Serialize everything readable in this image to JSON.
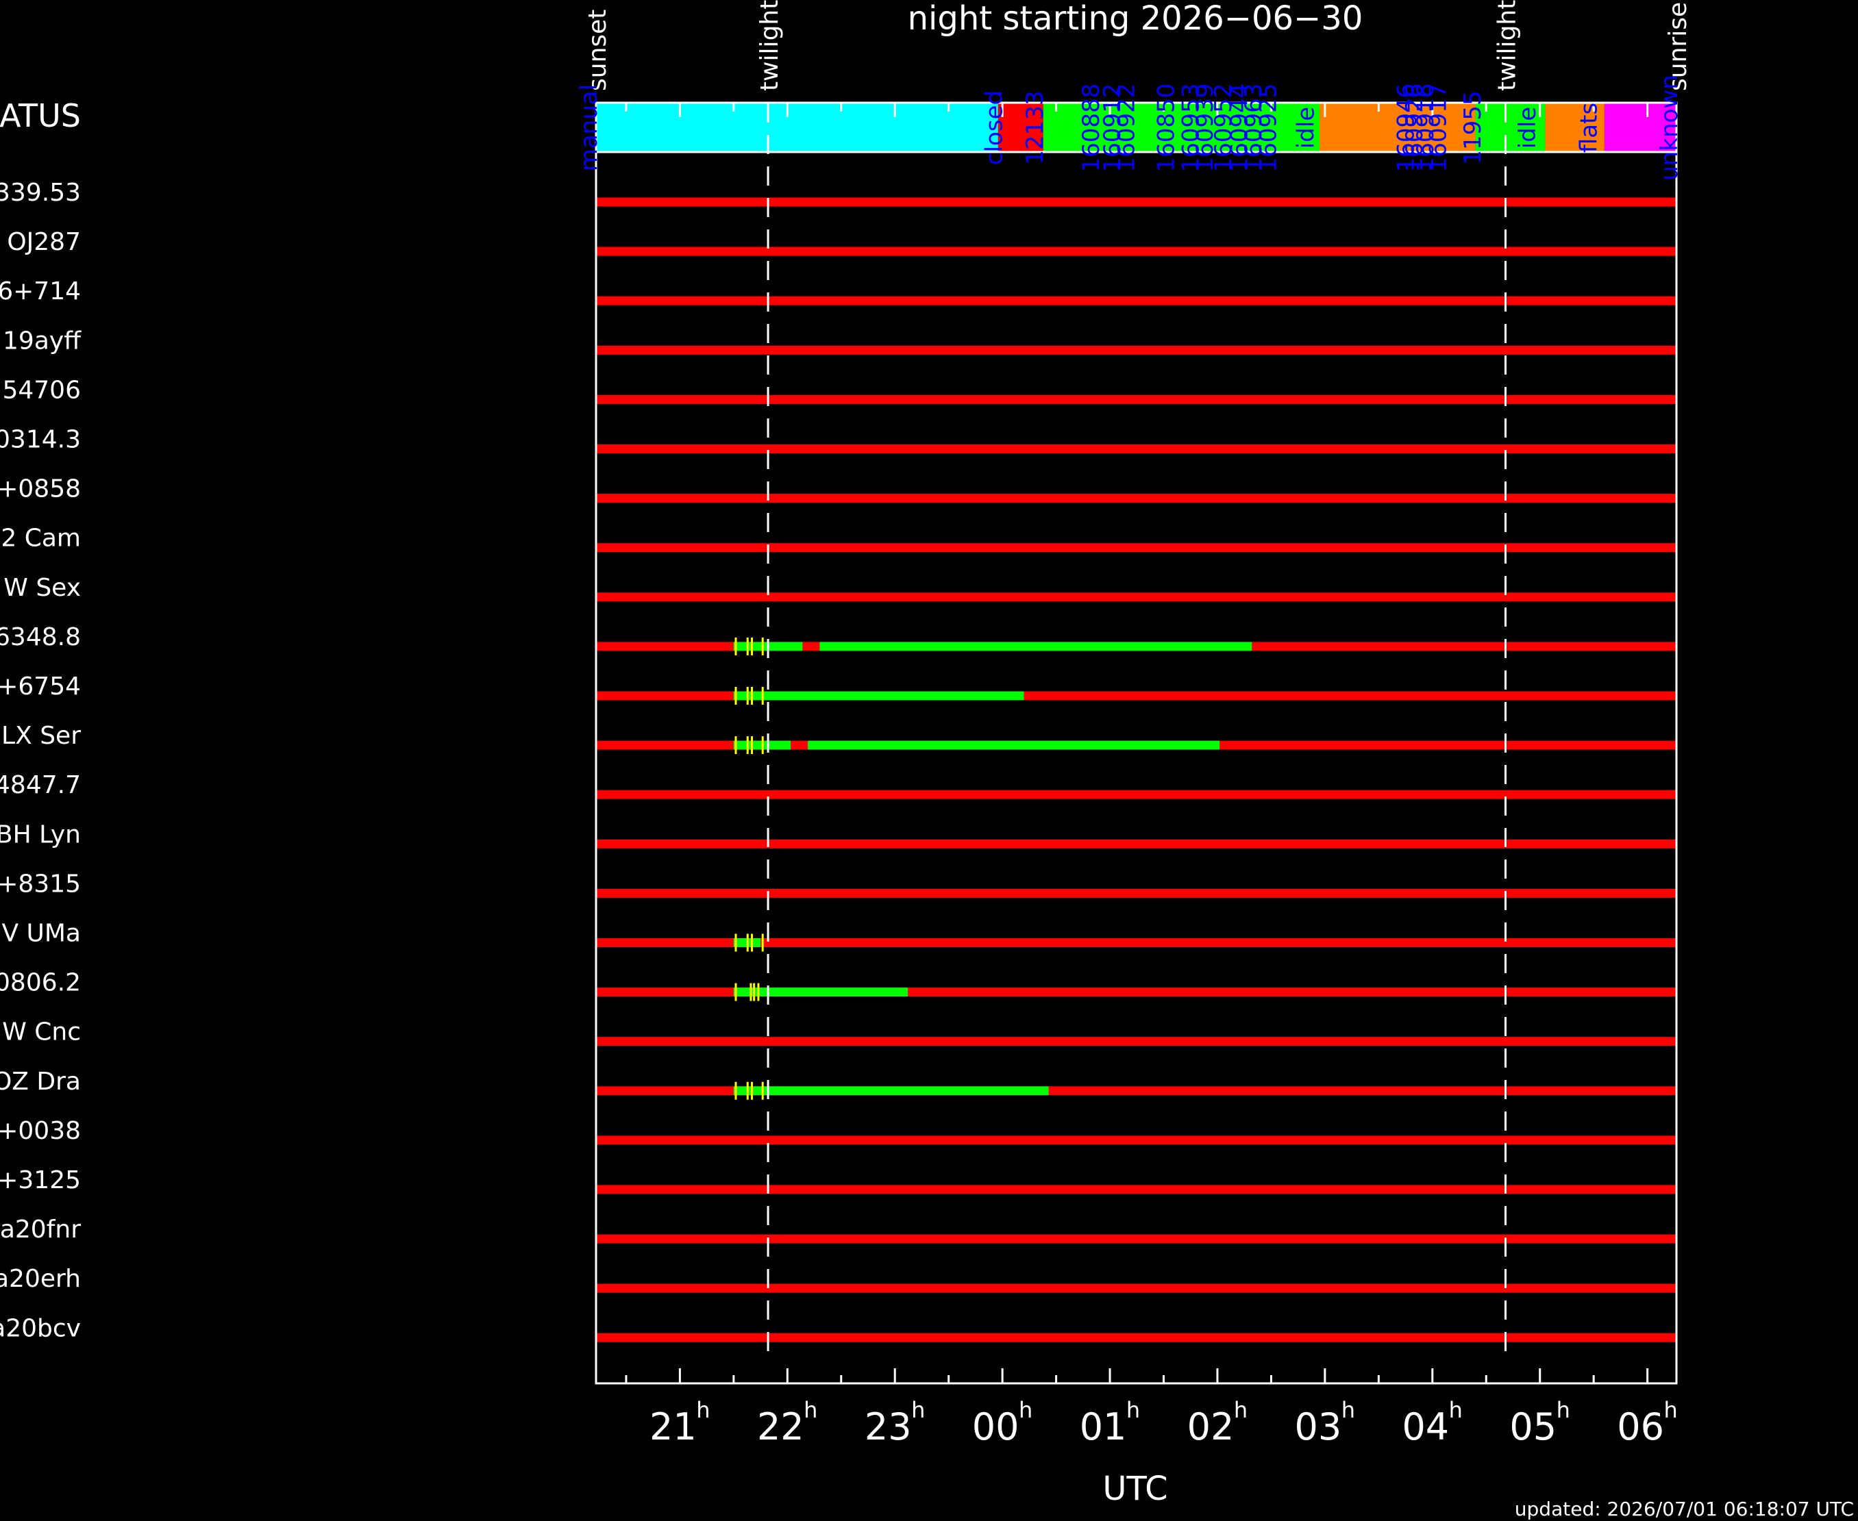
{
  "title": "night starting 2026−06−30",
  "xlabel": "UTC",
  "updated": "updated: 2026/07/01 06:18:07 UTC",
  "status_label": "ATUS",
  "colors": {
    "background": "#000000",
    "axis": "#ffffff",
    "red": "#ff0000",
    "green": "#00ff00",
    "yellow": "#ffff00",
    "cyan": "#00ffff",
    "orange": "#ff8000",
    "magenta": "#ff00ff",
    "blue_text": "#0000ff"
  },
  "chart_data": {
    "type": "timeline",
    "x_unit": "hours UTC (relative to 00h on night start)",
    "xlim": [
      -3.78,
      6.27
    ],
    "xticks": [
      {
        "value": -3,
        "label": "21",
        "sup": "h"
      },
      {
        "value": -2,
        "label": "22",
        "sup": "h"
      },
      {
        "value": -1,
        "label": "23",
        "sup": "h"
      },
      {
        "value": 0,
        "label": "00",
        "sup": "h"
      },
      {
        "value": 1,
        "label": "01",
        "sup": "h"
      },
      {
        "value": 2,
        "label": "02",
        "sup": "h"
      },
      {
        "value": 3,
        "label": "03",
        "sup": "h"
      },
      {
        "value": 4,
        "label": "04",
        "sup": "h"
      },
      {
        "value": 5,
        "label": "05",
        "sup": "h"
      },
      {
        "value": 6,
        "label": "06",
        "sup": "h"
      }
    ],
    "events": [
      {
        "label": "sunset",
        "time": -3.78,
        "dashed": false
      },
      {
        "label": "twilight",
        "time": -2.18,
        "dashed": true
      },
      {
        "label": "twilight",
        "time": 4.68,
        "dashed": true
      },
      {
        "label": "sunrise",
        "time": 6.27,
        "dashed": false
      }
    ],
    "status_bar": [
      {
        "start": -3.78,
        "end": -0.04,
        "color": "cyan"
      },
      {
        "start": -0.04,
        "end": 0.38,
        "color": "red"
      },
      {
        "start": 0.38,
        "end": 2.95,
        "color": "green"
      },
      {
        "start": 2.95,
        "end": 4.4,
        "color": "orange"
      },
      {
        "start": 4.4,
        "end": 5.05,
        "color": "green"
      },
      {
        "start": 5.05,
        "end": 5.6,
        "color": "orange"
      },
      {
        "start": 5.6,
        "end": 6.27,
        "color": "magenta"
      }
    ],
    "status_labels": [
      {
        "text": "manual",
        "time": -3.85
      },
      {
        "text": "closed",
        "time": -0.08
      },
      {
        "text": "12133",
        "time": 0.3
      },
      {
        "text": "160888",
        "time": 0.82
      },
      {
        "text": "160912",
        "time": 1.02
      },
      {
        "text": "160922",
        "time": 1.15
      },
      {
        "text": "160850",
        "time": 1.52
      },
      {
        "text": "160953",
        "time": 1.75
      },
      {
        "text": "160939",
        "time": 1.88
      },
      {
        "text": "160952",
        "time": 2.05
      },
      {
        "text": "160944",
        "time": 2.2
      },
      {
        "text": "160963",
        "time": 2.33
      },
      {
        "text": "160925",
        "time": 2.47
      },
      {
        "text": "idle",
        "time": 2.82
      },
      {
        "text": "160946",
        "time": 3.75
      },
      {
        "text": "160926",
        "time": 3.83
      },
      {
        "text": "160916",
        "time": 3.93
      },
      {
        "text": "160917",
        "time": 4.05
      },
      {
        "text": "11955",
        "time": 4.37
      },
      {
        "text": "idle",
        "time": 4.88
      },
      {
        "text": "flats",
        "time": 5.45
      },
      {
        "text": "unknown",
        "time": 6.2
      }
    ],
    "rows": [
      {
        "label": "339.53",
        "segments": []
      },
      {
        "label": "OJ287",
        "segments": []
      },
      {
        "label": "6+714",
        "segments": []
      },
      {
        "label": "19ayff",
        "segments": []
      },
      {
        "label": "54706",
        "segments": []
      },
      {
        "label": "0314.3",
        "segments": []
      },
      {
        "label": "+0858",
        "segments": []
      },
      {
        "label": "2 Cam",
        "segments": []
      },
      {
        "label": "W Sex",
        "segments": []
      },
      {
        "label": "6348.8",
        "segments": [
          {
            "start": -2.5,
            "end": -1.86,
            "color": "green"
          },
          {
            "start": -1.7,
            "end": 2.32,
            "color": "green"
          }
        ],
        "ticks": [
          -2.48,
          -2.37,
          -2.33,
          -2.23
        ]
      },
      {
        "label": "+6754",
        "segments": [
          {
            "start": -2.5,
            "end": 0.2,
            "color": "green"
          }
        ],
        "ticks": [
          -2.48,
          -2.37,
          -2.33,
          -2.23
        ]
      },
      {
        "label": "LX Ser",
        "segments": [
          {
            "start": -2.5,
            "end": -1.97,
            "color": "green"
          },
          {
            "start": -1.81,
            "end": 2.02,
            "color": "green"
          }
        ],
        "ticks": [
          -2.48,
          -2.37,
          -2.33,
          -2.23
        ]
      },
      {
        "label": "4847.7",
        "segments": []
      },
      {
        "label": "BH Lyn",
        "segments": []
      },
      {
        "label": "+8315",
        "segments": []
      },
      {
        "label": "V UMa",
        "segments": [
          {
            "start": -2.5,
            "end": -2.25,
            "color": "green"
          }
        ],
        "ticks": [
          -2.48,
          -2.37,
          -2.33,
          -2.23
        ]
      },
      {
        "label": "0806.2",
        "segments": [
          {
            "start": -2.5,
            "end": -0.88,
            "color": "green"
          }
        ],
        "ticks": [
          -2.48,
          -2.34,
          -2.31,
          -2.27
        ]
      },
      {
        "label": "W Cnc",
        "segments": []
      },
      {
        "label": "OZ Dra",
        "segments": [
          {
            "start": -2.5,
            "end": 0.43,
            "color": "green"
          }
        ],
        "ticks": [
          -2.48,
          -2.37,
          -2.33,
          -2.23
        ]
      },
      {
        "label": "+0038",
        "segments": []
      },
      {
        "label": "+3125",
        "segments": []
      },
      {
        "label": "a20fnr",
        "segments": []
      },
      {
        "label": "a20erh",
        "segments": []
      },
      {
        "label": "a20bcv",
        "segments": []
      }
    ]
  }
}
